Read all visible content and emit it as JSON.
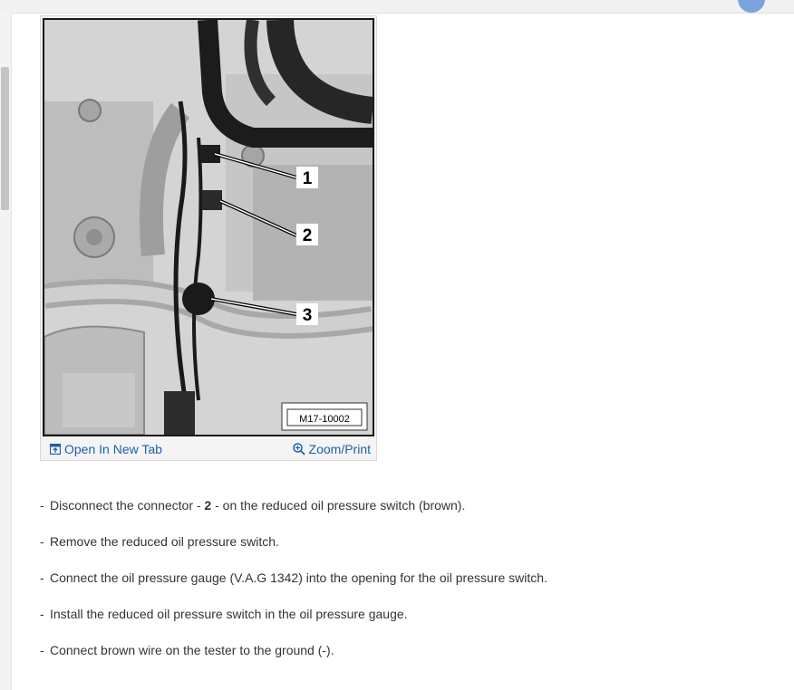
{
  "figure": {
    "image_code": "M17-10002",
    "callouts": [
      "1",
      "2",
      "3"
    ],
    "open_link": "Open In New Tab",
    "zoom_link": "Zoom/Print",
    "icons": {
      "open": "open-in-new-tab-icon",
      "zoom": "zoom-icon"
    },
    "link_color": "#1f5fa8"
  },
  "steps": [
    {
      "dash": "-",
      "before": "Disconnect the connector - ",
      "bold": "2",
      "after": " - on the reduced oil pressure switch (brown)."
    },
    {
      "dash": "-",
      "before": "Remove the reduced oil pressure switch.",
      "bold": "",
      "after": ""
    },
    {
      "dash": "-",
      "before": "Connect the oil pressure gauge (V.A.G 1342) into the opening for the oil pressure switch.",
      "bold": "",
      "after": ""
    },
    {
      "dash": "-",
      "before": "Install the reduced oil pressure switch in the oil pressure gauge.",
      "bold": "",
      "after": ""
    },
    {
      "dash": "-",
      "before": "Connect brown wire on the tester to the ground (-).",
      "bold": "",
      "after": ""
    }
  ]
}
